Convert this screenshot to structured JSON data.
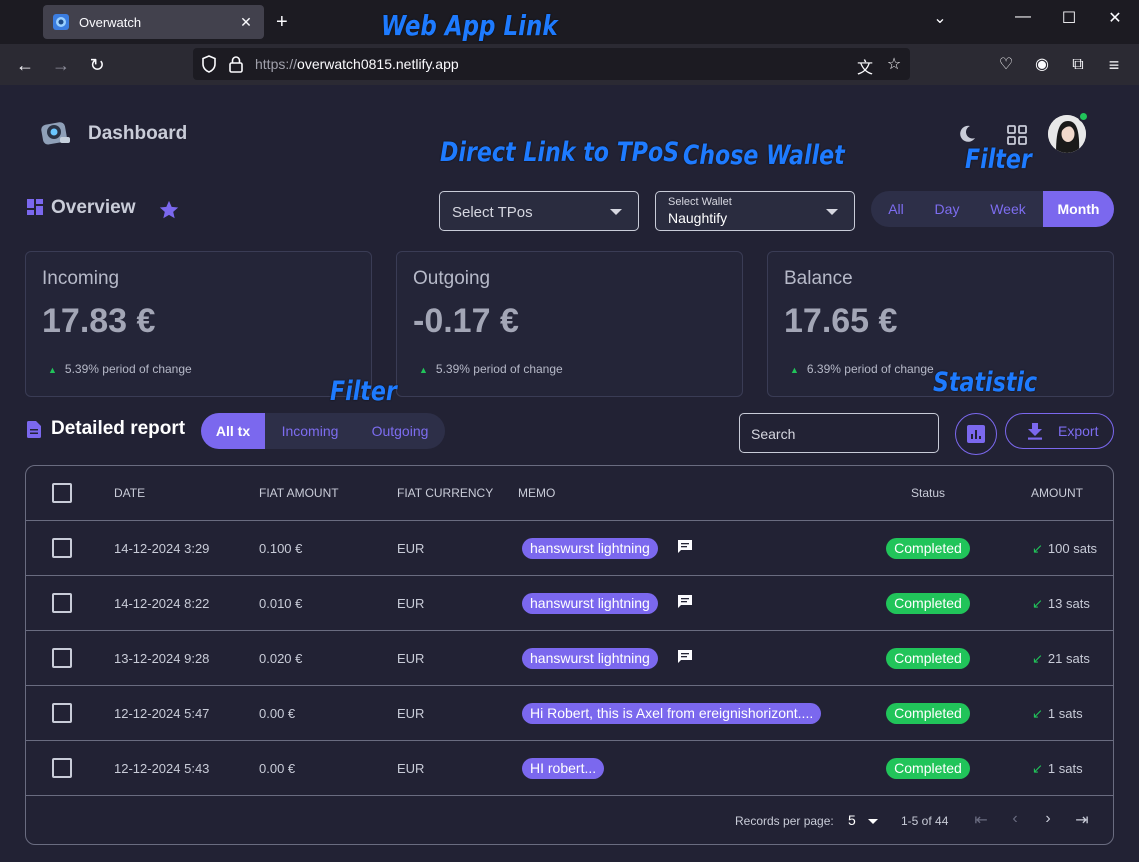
{
  "browser": {
    "tab_title": "Overwatch",
    "url_protocol": "https://",
    "url_host": "overwatch0815.netlify.app"
  },
  "app": {
    "brand": "Dashboard",
    "overview_title": "Overview",
    "tpos_select": {
      "placeholder": "Select TPos"
    },
    "wallet_select": {
      "label": "Select Wallet",
      "value": "Naughtify"
    },
    "period_options": [
      "All",
      "Day",
      "Week",
      "Month"
    ],
    "period_selected": "Month",
    "cards": [
      {
        "title": "Incoming",
        "value": "17.83 €",
        "change": "5.39% period of change"
      },
      {
        "title": "Outgoing",
        "value": "-0.17 €",
        "change": "5.39% period of change"
      },
      {
        "title": "Balance",
        "value": "17.65 €",
        "change": "6.39% period of change"
      }
    ],
    "report": {
      "title": "Detailed report",
      "filters": [
        "All tx",
        "Incoming",
        "Outgoing"
      ],
      "filter_selected": "All tx",
      "search_placeholder": "Search",
      "export_label": "Export",
      "columns": [
        "DATE",
        "FIAT AMOUNT",
        "FIAT CURRENCY",
        "MEMO",
        "Status",
        "AMOUNT"
      ],
      "rows": [
        {
          "date": "14-12-2024 3:29",
          "fiat_amount": "0.100 €",
          "currency": "EUR",
          "memo": "hanswurst lightning",
          "has_note": true,
          "status": "Completed",
          "amount": "100 sats"
        },
        {
          "date": "14-12-2024 8:22",
          "fiat_amount": "0.010 €",
          "currency": "EUR",
          "memo": "hanswurst lightning",
          "has_note": true,
          "status": "Completed",
          "amount": "13 sats"
        },
        {
          "date": "13-12-2024 9:28",
          "fiat_amount": "0.020 €",
          "currency": "EUR",
          "memo": "hanswurst lightning",
          "has_note": true,
          "status": "Completed",
          "amount": "21 sats"
        },
        {
          "date": "12-12-2024 5:47",
          "fiat_amount": "0.00 €",
          "currency": "EUR",
          "memo": "Hi Robert, this is Axel from ereignishorizont....",
          "has_note": false,
          "status": "Completed",
          "amount": "1 sats"
        },
        {
          "date": "12-12-2024 5:43",
          "fiat_amount": "0.00 €",
          "currency": "EUR",
          "memo": "HI robert...",
          "has_note": false,
          "status": "Completed",
          "amount": "1 sats"
        }
      ],
      "pagination": {
        "records_label": "Records per page:",
        "per_page": "5",
        "range": "1-5 of 44"
      }
    }
  },
  "annotations": {
    "web_app_link": "Web App Link",
    "direct_link": "Direct Link to TPoS",
    "chose_wallet": "Chose Wallet",
    "filter_top": "Filter",
    "filter_report": "Filter",
    "statistic": "Statistic"
  },
  "colors": {
    "accent": "#7b68ee",
    "success": "#21c45a",
    "background": "#222234",
    "annotation": "#1e7bff"
  },
  "icons": [
    "firefox-tab-icon",
    "shield-icon",
    "lock-icon",
    "translate-icon",
    "star-bookmark-icon",
    "pocket-icon",
    "account-icon",
    "extensions-icon",
    "menu-icon",
    "logo-icon",
    "moon-icon",
    "apps-grid-icon",
    "avatar",
    "dashboard-icon",
    "star-icon",
    "document-icon",
    "chart-icon",
    "download-icon",
    "comment-icon",
    "arrow-down-left-icon"
  ]
}
